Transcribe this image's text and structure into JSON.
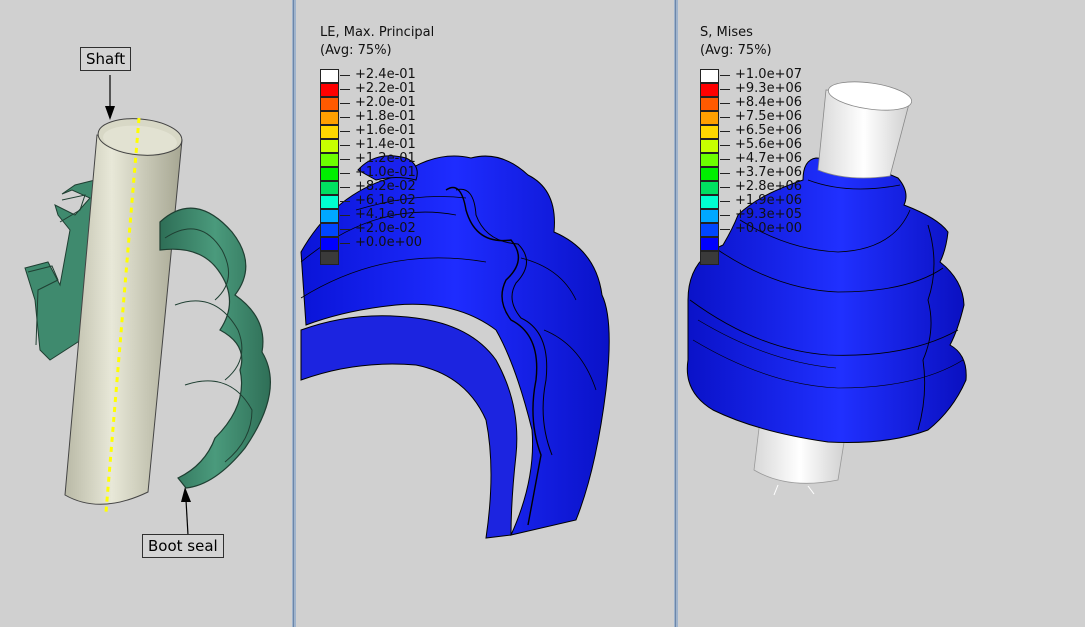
{
  "left_panel": {
    "callouts": {
      "shaft": "Shaft",
      "boot_seal": "Boot seal"
    }
  },
  "middle_panel": {
    "legend": {
      "title_line1": "LE, Max. Principal",
      "title_line2": "(Avg: 75%)",
      "entries": [
        {
          "label": "+2.4e-01",
          "color": "#ffffff"
        },
        {
          "label": "+2.2e-01",
          "color": "#ff0000"
        },
        {
          "label": "+2.0e-01",
          "color": "#ff5a00"
        },
        {
          "label": "+1.8e-01",
          "color": "#ffa000"
        },
        {
          "label": "+1.6e-01",
          "color": "#ffd800"
        },
        {
          "label": "+1.4e-01",
          "color": "#c8ff00"
        },
        {
          "label": "+1.2e-01",
          "color": "#6cff00"
        },
        {
          "label": "+1.0e-01",
          "color": "#00f000"
        },
        {
          "label": "+8.2e-02",
          "color": "#00e060"
        },
        {
          "label": "+6.1e-02",
          "color": "#00ffd0"
        },
        {
          "label": "+4.1e-02",
          "color": "#00a8ff"
        },
        {
          "label": "+2.0e-02",
          "color": "#0046ff"
        },
        {
          "label": "+0.0e+00",
          "color": "#0000ff"
        },
        {
          "label": "",
          "color": "#3a3a3a"
        }
      ]
    }
  },
  "right_panel": {
    "legend": {
      "title_line1": "S, Mises",
      "title_line2": "(Avg: 75%)",
      "entries": [
        {
          "label": "+1.0e+07",
          "color": "#ffffff"
        },
        {
          "label": "+9.3e+06",
          "color": "#ff0000"
        },
        {
          "label": "+8.4e+06",
          "color": "#ff5a00"
        },
        {
          "label": "+7.5e+06",
          "color": "#ffa000"
        },
        {
          "label": "+6.5e+06",
          "color": "#ffd800"
        },
        {
          "label": "+5.6e+06",
          "color": "#c8ff00"
        },
        {
          "label": "+4.7e+06",
          "color": "#6cff00"
        },
        {
          "label": "+3.7e+06",
          "color": "#00f000"
        },
        {
          "label": "+2.8e+06",
          "color": "#00e060"
        },
        {
          "label": "+1.9e+06",
          "color": "#00ffd0"
        },
        {
          "label": "+9.3e+05",
          "color": "#00a8ff"
        },
        {
          "label": "+0.0e+00",
          "color": "#0046ff"
        },
        {
          "label": "",
          "color": "#0000ff"
        },
        {
          "label": "",
          "color": "#3a3a3a"
        }
      ]
    }
  },
  "colors": {
    "background": "#d0d0d0",
    "boot_green": "#3f8a6e",
    "shaft": "#dcdccb",
    "contour_blue": "#0a14e6",
    "axis_line": "#ffff00"
  }
}
